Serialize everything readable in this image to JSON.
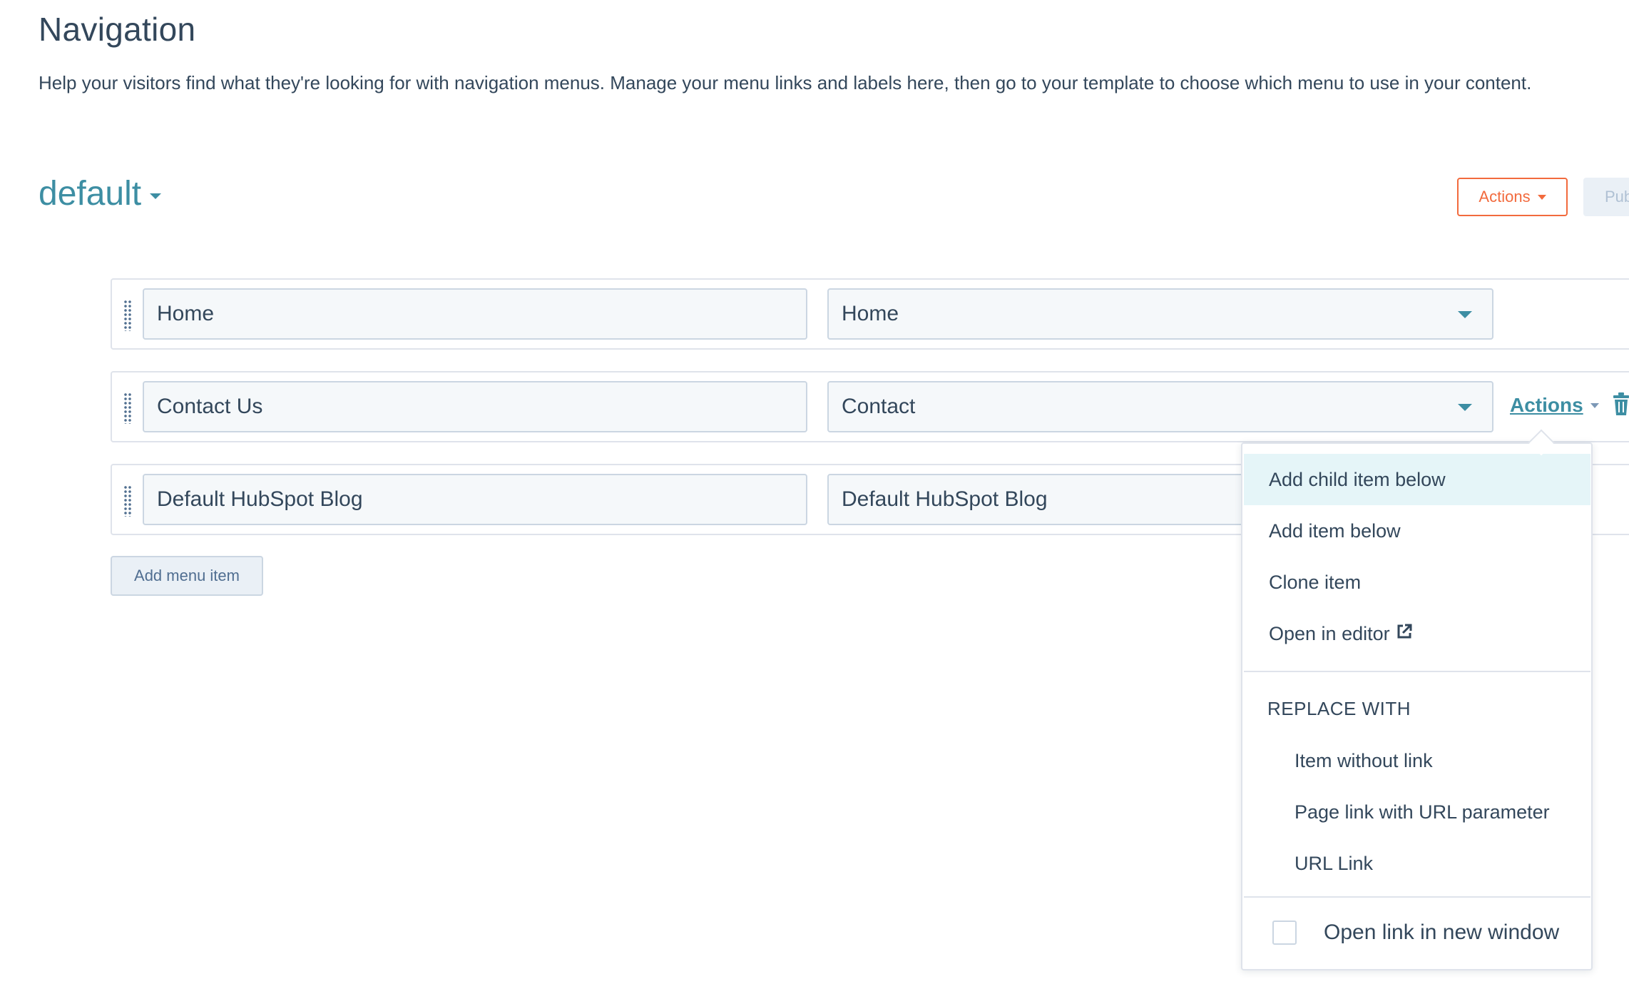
{
  "header": {
    "title": "Navigation",
    "description": "Help your visitors find what they're looking for with navigation menus. Manage your menu links and labels here, then go to your template to choose which menu to use in your content."
  },
  "menu": {
    "name": "default",
    "actions_label": "Actions",
    "publish_label": "Pub"
  },
  "items": [
    {
      "label": "Home",
      "link": "Home"
    },
    {
      "label": "Contact Us",
      "link": "Contact",
      "actions_label": "Actions"
    },
    {
      "label": "Default HubSpot Blog",
      "link": "Default HubSpot Blog"
    }
  ],
  "add_menu_item_label": "Add menu item",
  "dropdown": {
    "items": [
      {
        "label": "Add child item below",
        "highlighted": true
      },
      {
        "label": "Add item below"
      },
      {
        "label": "Clone item"
      },
      {
        "label": "Open in editor",
        "icon": "external-link-icon"
      }
    ],
    "replace_header": "REPLACE WITH",
    "replace_items": [
      {
        "label": "Item without link"
      },
      {
        "label": "Page link with URL parameter"
      },
      {
        "label": "URL Link"
      }
    ],
    "checkbox": {
      "label": "Open link in new window",
      "checked": false
    }
  },
  "colors": {
    "text": "#33475b",
    "accent": "#3d8ea3",
    "orange": "#f26a3d",
    "highlight": "#e5f5f8"
  }
}
